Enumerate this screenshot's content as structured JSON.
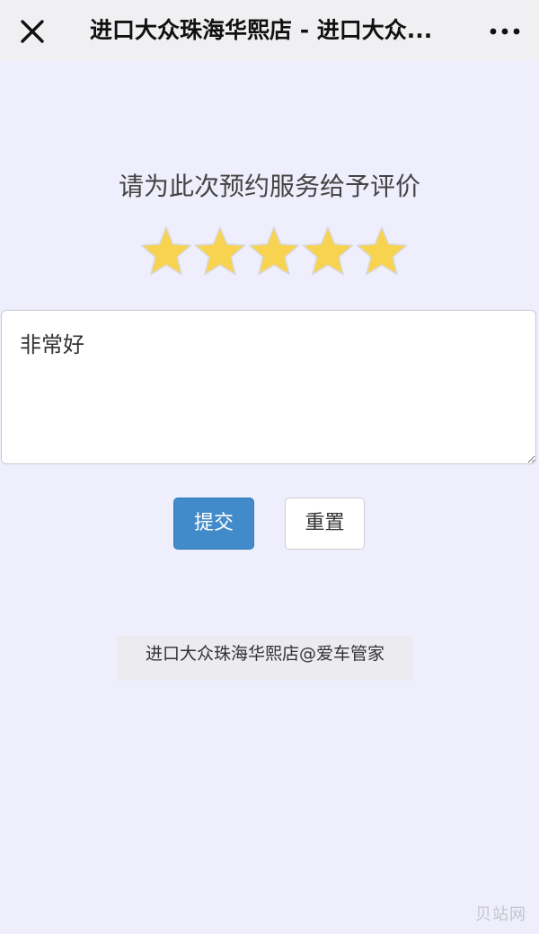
{
  "topbar": {
    "title": "进口大众珠海华熙店 - 进口大众...",
    "close_icon": "close-icon",
    "more_icon": "more-horizontal-icon"
  },
  "review": {
    "prompt": "请为此次预约服务给予评价",
    "rating": 5,
    "rating_max": 5,
    "star_color": "#f7d34f",
    "comment_value": "非常好"
  },
  "actions": {
    "submit_label": "提交",
    "reset_label": "重置",
    "submit_color": "#428bca"
  },
  "footer": {
    "text": "进口大众珠海华熙店@爱车管家"
  },
  "watermark": {
    "text": "贝站网"
  }
}
